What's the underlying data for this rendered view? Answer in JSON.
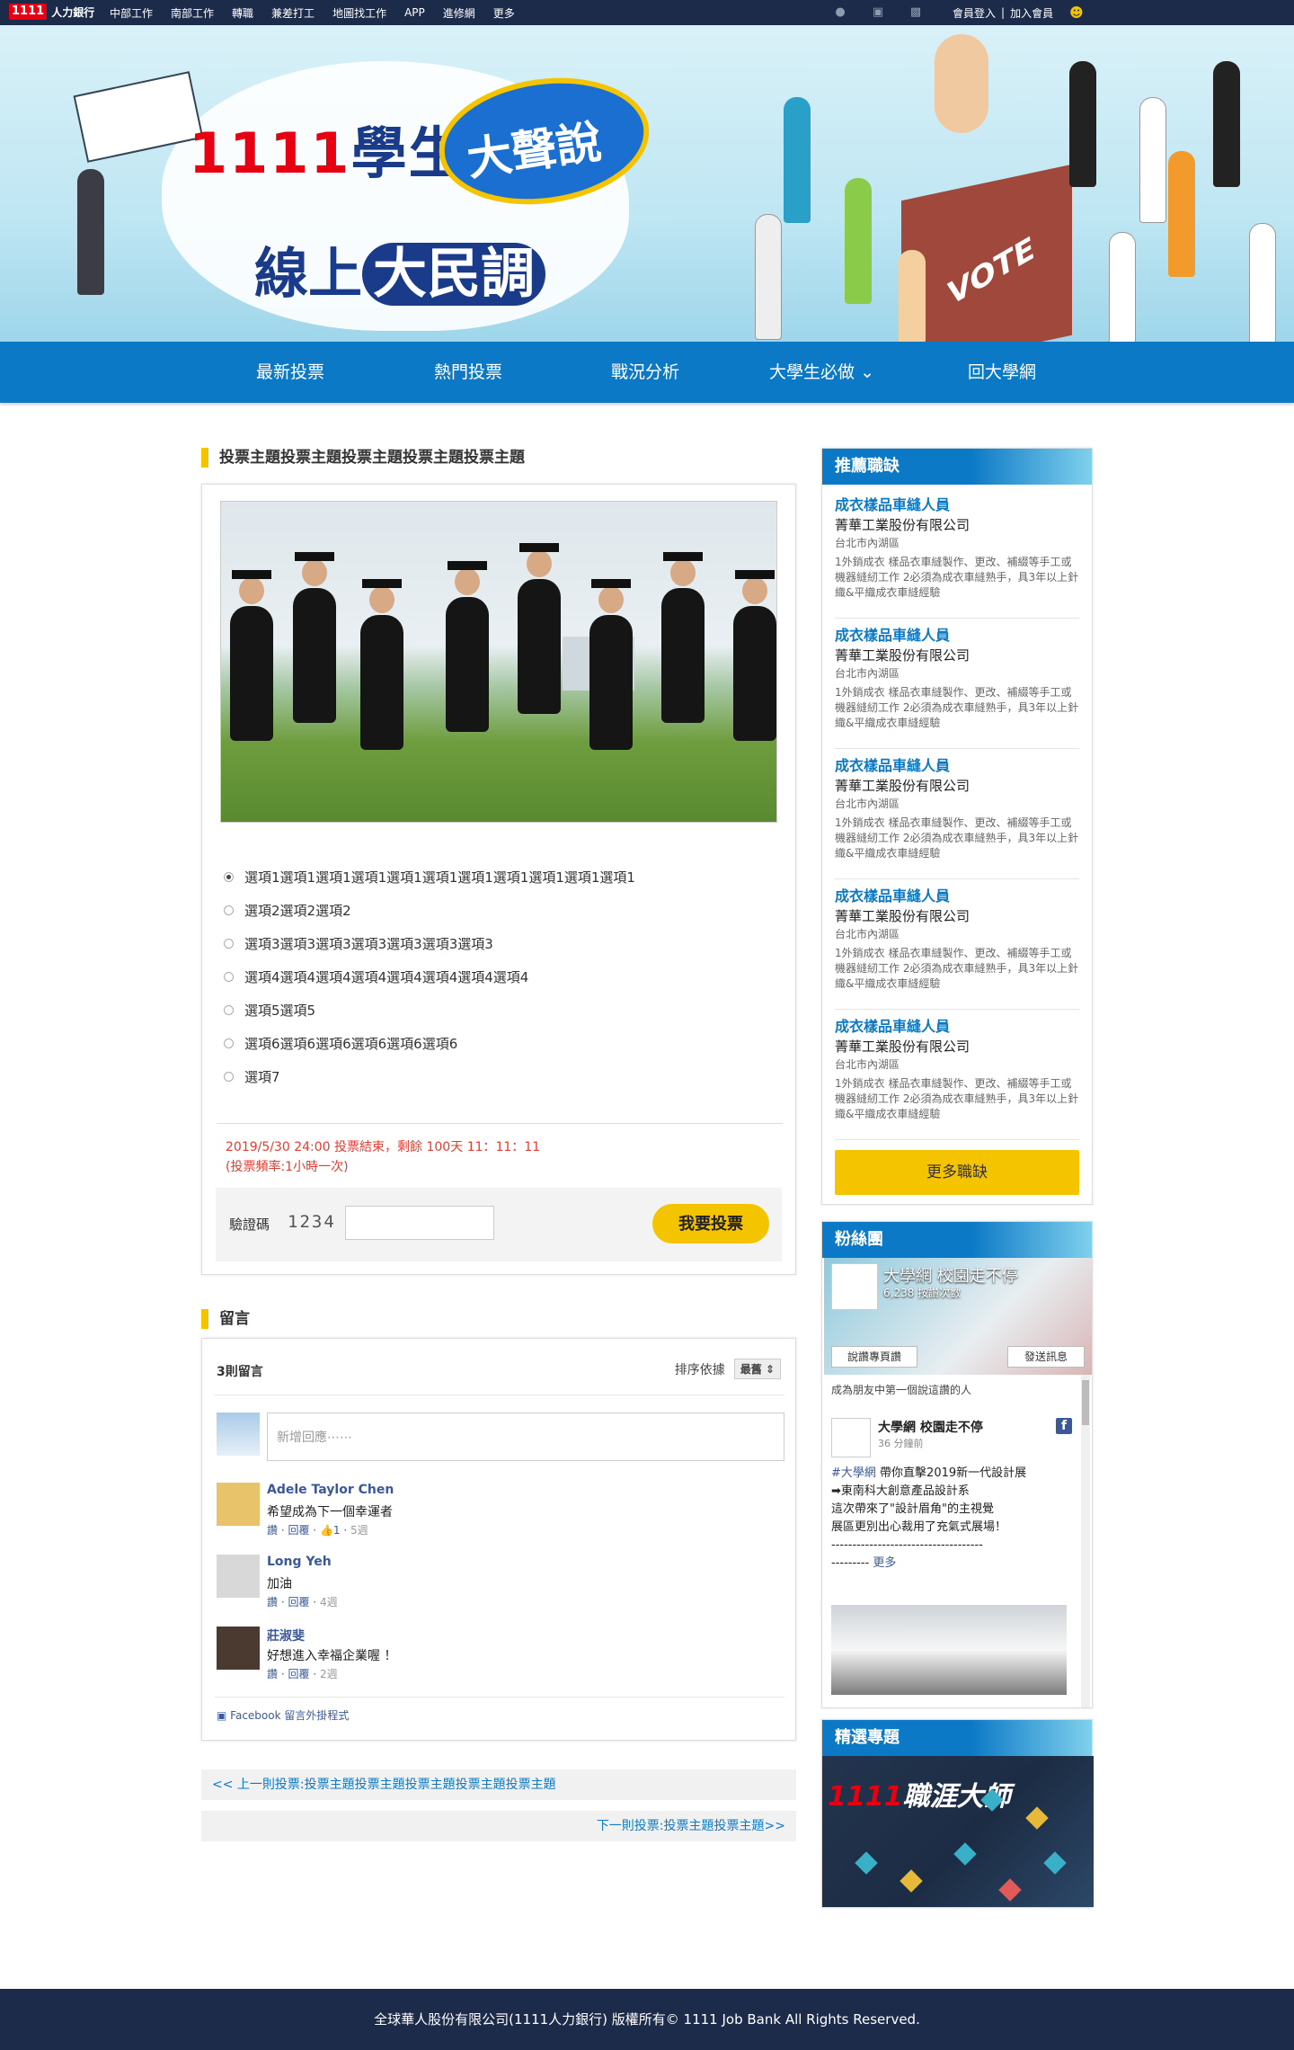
{
  "topbar": {
    "logo_mark": "1111",
    "logo_name": "人力銀行",
    "nav": [
      "中部工作",
      "南部工作",
      "轉職",
      "兼差打工",
      "地圖找工作",
      "APP",
      "進修網",
      "更多"
    ],
    "login": "會員登入",
    "separator": "|",
    "join": "加入會員",
    "icons": [
      "bell-icon",
      "search-doc-icon",
      "briefcase-icon",
      "user-icon"
    ]
  },
  "hero": {
    "title_num": "1111",
    "title_main": "學生",
    "bubble": "大聲說",
    "subtitle_a": "線上",
    "subtitle_b": "大民調",
    "box_label": "VOTE"
  },
  "mainnav": [
    "最新投票",
    "熱門投票",
    "戰況分析",
    "大學生必做",
    "回大學網"
  ],
  "poll": {
    "title": "投票主題投票主題投票主題投票主題投票主題",
    "options": [
      {
        "label": "選項1選項1選項1選項1選項1選項1選項1選項1選項1選項1選項1",
        "selected": true
      },
      {
        "label": "選項2選項2選項2",
        "selected": false
      },
      {
        "label": "選項3選項3選項3選項3選項3選項3選項3",
        "selected": false
      },
      {
        "label": "選項4選項4選項4選項4選項4選項4選項4選項4",
        "selected": false
      },
      {
        "label": "選項5選項5",
        "selected": false
      },
      {
        "label": "選項6選項6選項6選項6選項6選項6",
        "selected": false
      },
      {
        "label": "選項7",
        "selected": false
      }
    ],
    "end_line": "2019/5/30 24:00 投票結束，剩餘 100天 11：11：11",
    "frequency": "(投票頻率:1小時一次)",
    "verify_label": "驗證碼",
    "verify_code": "1234",
    "vote_button": "我要投票"
  },
  "comments": {
    "title": "留言",
    "count": "3則留言",
    "sort_label": "排序依據",
    "sort_value": "最舊",
    "placeholder": "新增回應⋯⋯",
    "items": [
      {
        "name": "Adele Taylor Chen",
        "text": "希望成為下一個幸運者",
        "like": "讚",
        "reply": "回覆",
        "reactions": "1",
        "time": "5週"
      },
      {
        "name": "Long Yeh",
        "text": "加油",
        "like": "讚",
        "reply": "回覆",
        "reactions": "",
        "time": "4週"
      },
      {
        "name": "莊淑斐",
        "text": "好想進入幸福企業喔 ！",
        "like": "讚",
        "reply": "回覆",
        "reactions": "",
        "time": "2週"
      }
    ],
    "plugin": "Facebook 留言外掛程式"
  },
  "prev_link": "<< 上一則投票:投票主題投票主題投票主題投票主題投票主題",
  "next_link": "下一則投票:投票主題投票主題>>",
  "jobs": {
    "title": "推薦職缺",
    "items": [
      {
        "title": "成衣樣品車縫人員",
        "company": "菁華工業股份有限公司",
        "location": "台北市內湖區",
        "desc": "1外銷成衣 樣品衣車縫製作、更改、補綴等手工或機器縫紉工作 2必須為成衣車縫熟手，具3年以上針織&平織成衣車縫經驗"
      },
      {
        "title": "成衣樣品車縫人員",
        "company": "菁華工業股份有限公司",
        "location": "台北市內湖區",
        "desc": "1外銷成衣 樣品衣車縫製作、更改、補綴等手工或機器縫紉工作 2必須為成衣車縫熟手，具3年以上針織&平織成衣車縫經驗"
      },
      {
        "title": "成衣樣品車縫人員",
        "company": "菁華工業股份有限公司",
        "location": "台北市內湖區",
        "desc": "1外銷成衣 樣品衣車縫製作、更改、補綴等手工或機器縫紉工作 2必須為成衣車縫熟手，具3年以上針織&平織成衣車縫經驗"
      },
      {
        "title": "成衣樣品車縫人員",
        "company": "菁華工業股份有限公司",
        "location": "台北市內湖區",
        "desc": "1外銷成衣 樣品衣車縫製作、更改、補綴等手工或機器縫紉工作 2必須為成衣車縫熟手，具3年以上針織&平織成衣車縫經驗"
      },
      {
        "title": "成衣樣品車縫人員",
        "company": "菁華工業股份有限公司",
        "location": "台北市內湖區",
        "desc": "1外銷成衣 樣品衣車縫製作、更改、補綴等手工或機器縫紉工作 2必須為成衣車縫熟手，具3年以上針織&平織成衣車縫經驗"
      }
    ],
    "more_button": "更多職缺"
  },
  "fans": {
    "title": "粉絲團",
    "page_name": "大學網 校園走不停",
    "likes": "6,238 按讚次數",
    "like_page_button": "說讚專頁讚",
    "message_button": "發送訊息",
    "first_friend": "成為朋友中第一個說這讚的人",
    "post_name": "大學網 校園走不停",
    "post_time": "36 分鐘前",
    "post_tag": "#大學網",
    "post_line1": "帶你直擊2019新一代設計展",
    "post_line2": "➡東南科大創意產品設計系",
    "post_line3": "這次帶來了\"設計眉角\"的主視覺",
    "post_line4": "展區更別出心裁用了充氣式展場！",
    "post_dash": "------------------------------------",
    "post_more_dash": "---------",
    "post_more": "更多"
  },
  "topics": {
    "title": "精選專題",
    "banner_num": "1111",
    "banner_text": "職涯大師"
  },
  "footer": "全球華人股份有限公司(1111人力銀行) 版權所有© 1111 Job Bank All Rights Reserved.",
  "colors": {
    "brand_blue": "#0c79c6",
    "accent_yellow": "#f5c400",
    "dark_navy": "#1c2b4a",
    "alert_red": "#e83a2e"
  }
}
